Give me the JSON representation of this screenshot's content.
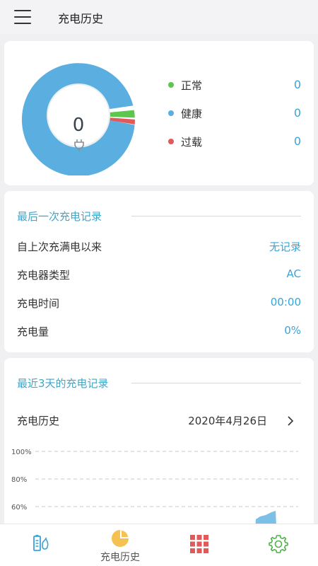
{
  "header": {
    "title": "充电历史"
  },
  "summary": {
    "count": "0",
    "legend": [
      {
        "label": "正常",
        "value": "0",
        "color": "#5cc64f"
      },
      {
        "label": "健康",
        "value": "0",
        "color": "#5aaee0"
      },
      {
        "label": "过载",
        "value": "0",
        "color": "#e05a5a"
      }
    ]
  },
  "last_record": {
    "title": "最后一次充电记录",
    "rows": [
      {
        "label": "自上次充满电以来",
        "value": "无记录"
      },
      {
        "label": "充电器类型",
        "value": "AC"
      },
      {
        "label": "充电时间",
        "value": "00:00"
      },
      {
        "label": "充电量",
        "value": "0%"
      }
    ]
  },
  "recent": {
    "title": "最近3天的充电记录",
    "history_label": "充电历史",
    "date": "2020年4月26日"
  },
  "chart_data": {
    "type": "area",
    "y_ticks": [
      "100%",
      "80%",
      "60%"
    ],
    "ylim": [
      0,
      100
    ],
    "grid": true
  },
  "nav": {
    "items": [
      {
        "icon": "battery-chart-icon",
        "label": ""
      },
      {
        "icon": "pie-chart-icon",
        "label": "充电历史"
      },
      {
        "icon": "grid-icon",
        "label": ""
      },
      {
        "icon": "gear-icon",
        "label": ""
      }
    ]
  }
}
